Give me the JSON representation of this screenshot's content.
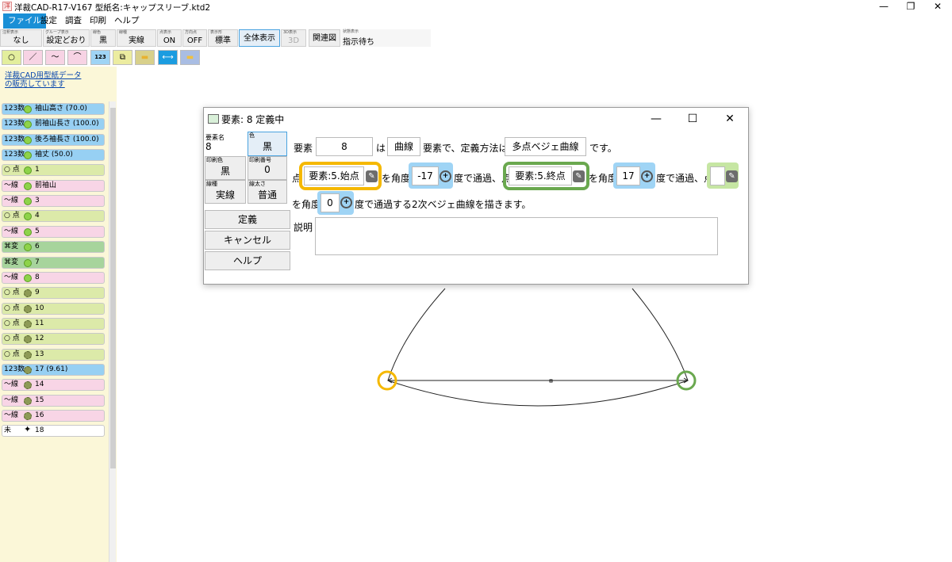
{
  "window": {
    "title": "洋裁CAD-R17-V167 型紙名:キャップスリーブ.ktd2",
    "app_icon_glyph": "洋",
    "minimize": "—",
    "restore": "❐",
    "close": "✕"
  },
  "menu": [
    "ファイル",
    "設定",
    "調査",
    "印刷",
    "ヘルプ"
  ],
  "toolbar": {
    "buttons": [
      {
        "caption": "注釈表示",
        "value": "なし"
      },
      {
        "caption": "グループ表示",
        "value": "設定どおり"
      },
      {
        "caption": "線色",
        "value": "黒"
      },
      {
        "caption": "線種",
        "value": "実線"
      },
      {
        "caption": "点表示",
        "value": "ON"
      },
      {
        "caption": "方向点",
        "value": "OFF"
      },
      {
        "caption": "表示形",
        "value": "標準"
      },
      {
        "caption": "",
        "value": "全体表示"
      },
      {
        "caption": "3D表示",
        "value": "3D"
      },
      {
        "caption": "",
        "value": "関連図"
      }
    ],
    "status_caption": "状態表示",
    "status_value": "指示待ち"
  },
  "tools": [
    {
      "icon": "point-tool-icon",
      "glyph": "○"
    },
    {
      "icon": "line-tool-icon",
      "glyph": "／"
    },
    {
      "icon": "curve-tool-icon",
      "glyph": "〜"
    },
    {
      "icon": "arc-tool-icon",
      "glyph": "⌒"
    },
    {
      "icon": "number-tool-icon",
      "glyph": "123"
    },
    {
      "icon": "group-tool-icon",
      "glyph": "⧉"
    },
    {
      "icon": "folder-open-icon",
      "glyph": "▬"
    },
    {
      "icon": "measure-icon",
      "glyph": "⟷"
    },
    {
      "icon": "folder-icon",
      "glyph": "▬"
    }
  ],
  "sidebar": {
    "promo_line1": "洋裁CAD用型紙データ",
    "promo_line2": "の販売しています",
    "items": [
      {
        "tag": "123数",
        "label": "袖山高さ (70.0)",
        "color": "blue",
        "dot": "g"
      },
      {
        "tag": "123数",
        "label": "前袖山長さ (100.0)",
        "color": "blue",
        "dot": "g"
      },
      {
        "tag": "123数",
        "label": "後ろ袖長さ (100.0)",
        "color": "blue",
        "dot": "g"
      },
      {
        "tag": "123数",
        "label": "袖丈 (50.0)",
        "color": "blue",
        "dot": "g"
      },
      {
        "tag": "○ 点",
        "label": "1",
        "color": "green",
        "dot": "g"
      },
      {
        "tag": "〜線",
        "label": "前袖山",
        "color": "pink",
        "dot": "g"
      },
      {
        "tag": "〜線",
        "label": "3",
        "color": "pink",
        "dot": "g"
      },
      {
        "tag": "○ 点",
        "label": "4",
        "color": "green",
        "dot": "g"
      },
      {
        "tag": "〜線",
        "label": "5",
        "color": "pink",
        "dot": "g"
      },
      {
        "tag": "⌘変",
        "label": "6",
        "color": "dgreen",
        "dot": "g"
      },
      {
        "tag": "⌘変",
        "label": "7",
        "color": "dgreen",
        "dot": "g"
      },
      {
        "tag": "〜線",
        "label": "8",
        "color": "pink",
        "dot": "g"
      },
      {
        "tag": "○ 点",
        "label": "9",
        "color": "green",
        "dot": "gear"
      },
      {
        "tag": "○ 点",
        "label": "10",
        "color": "green",
        "dot": "gear"
      },
      {
        "tag": "○ 点",
        "label": "11",
        "color": "green",
        "dot": "gear"
      },
      {
        "tag": "○ 点",
        "label": "12",
        "color": "green",
        "dot": "gear"
      },
      {
        "tag": "○ 点",
        "label": "13",
        "color": "green",
        "dot": "gear"
      },
      {
        "tag": "123数",
        "label": "17 (9.61)",
        "color": "blue",
        "dot": "gear"
      },
      {
        "tag": "〜線",
        "label": "14",
        "color": "pink",
        "dot": "gear"
      },
      {
        "tag": "〜線",
        "label": "15",
        "color": "pink",
        "dot": "gear"
      },
      {
        "tag": "〜線",
        "label": "16",
        "color": "pink",
        "dot": "gear"
      },
      {
        "tag": "未",
        "label": "18",
        "color": "white",
        "dot": "sparkle"
      }
    ]
  },
  "dialog": {
    "title": "要素: 8 定義中",
    "minimize": "—",
    "maximize": "☐",
    "close": "✕",
    "name_caption": "要素名",
    "name_value": "8",
    "color_caption": "色",
    "color_value": "黒",
    "print_color_caption": "印刷色",
    "print_color_value": "黒",
    "print_no_caption": "印刷番号",
    "print_no_value": "0",
    "linetype_caption": "線種",
    "linetype_value": "実線",
    "linewidth_caption": "線太さ",
    "linewidth_value": "普通",
    "define_btn": "定義",
    "cancel_btn": "キャンセル",
    "help_btn": "ヘルプ",
    "s_youso": "要素",
    "element_no": "8",
    "s_wa": "は",
    "element_type": "曲線",
    "s_method": "要素で、定義方法は",
    "method": "多点ベジェ曲線",
    "s_desu": "です。",
    "s_ten_a": "点",
    "start_point": "要素:5.始点",
    "s_angle1": "を角度",
    "angle1": "-17",
    "s_pass1": "度で通過、点",
    "end_point": "要素:5.終点",
    "s_angle2": "を角度",
    "angle2": "17",
    "s_pass2": "度で通過、点",
    "third_point": "",
    "s_angle3": "を角度",
    "angle3": "0",
    "s_tail": "度で通過する2次ベジェ曲線を描きます。",
    "desc_label": "説明",
    "desc_value": ""
  },
  "colors": {
    "accent_blue": "#1a8fd6",
    "highlight_yellow": "#f5b800",
    "highlight_green": "#6aa84f",
    "angle_box_blue": "#9fd4f5",
    "point_box_green": "#c6e6a3"
  }
}
